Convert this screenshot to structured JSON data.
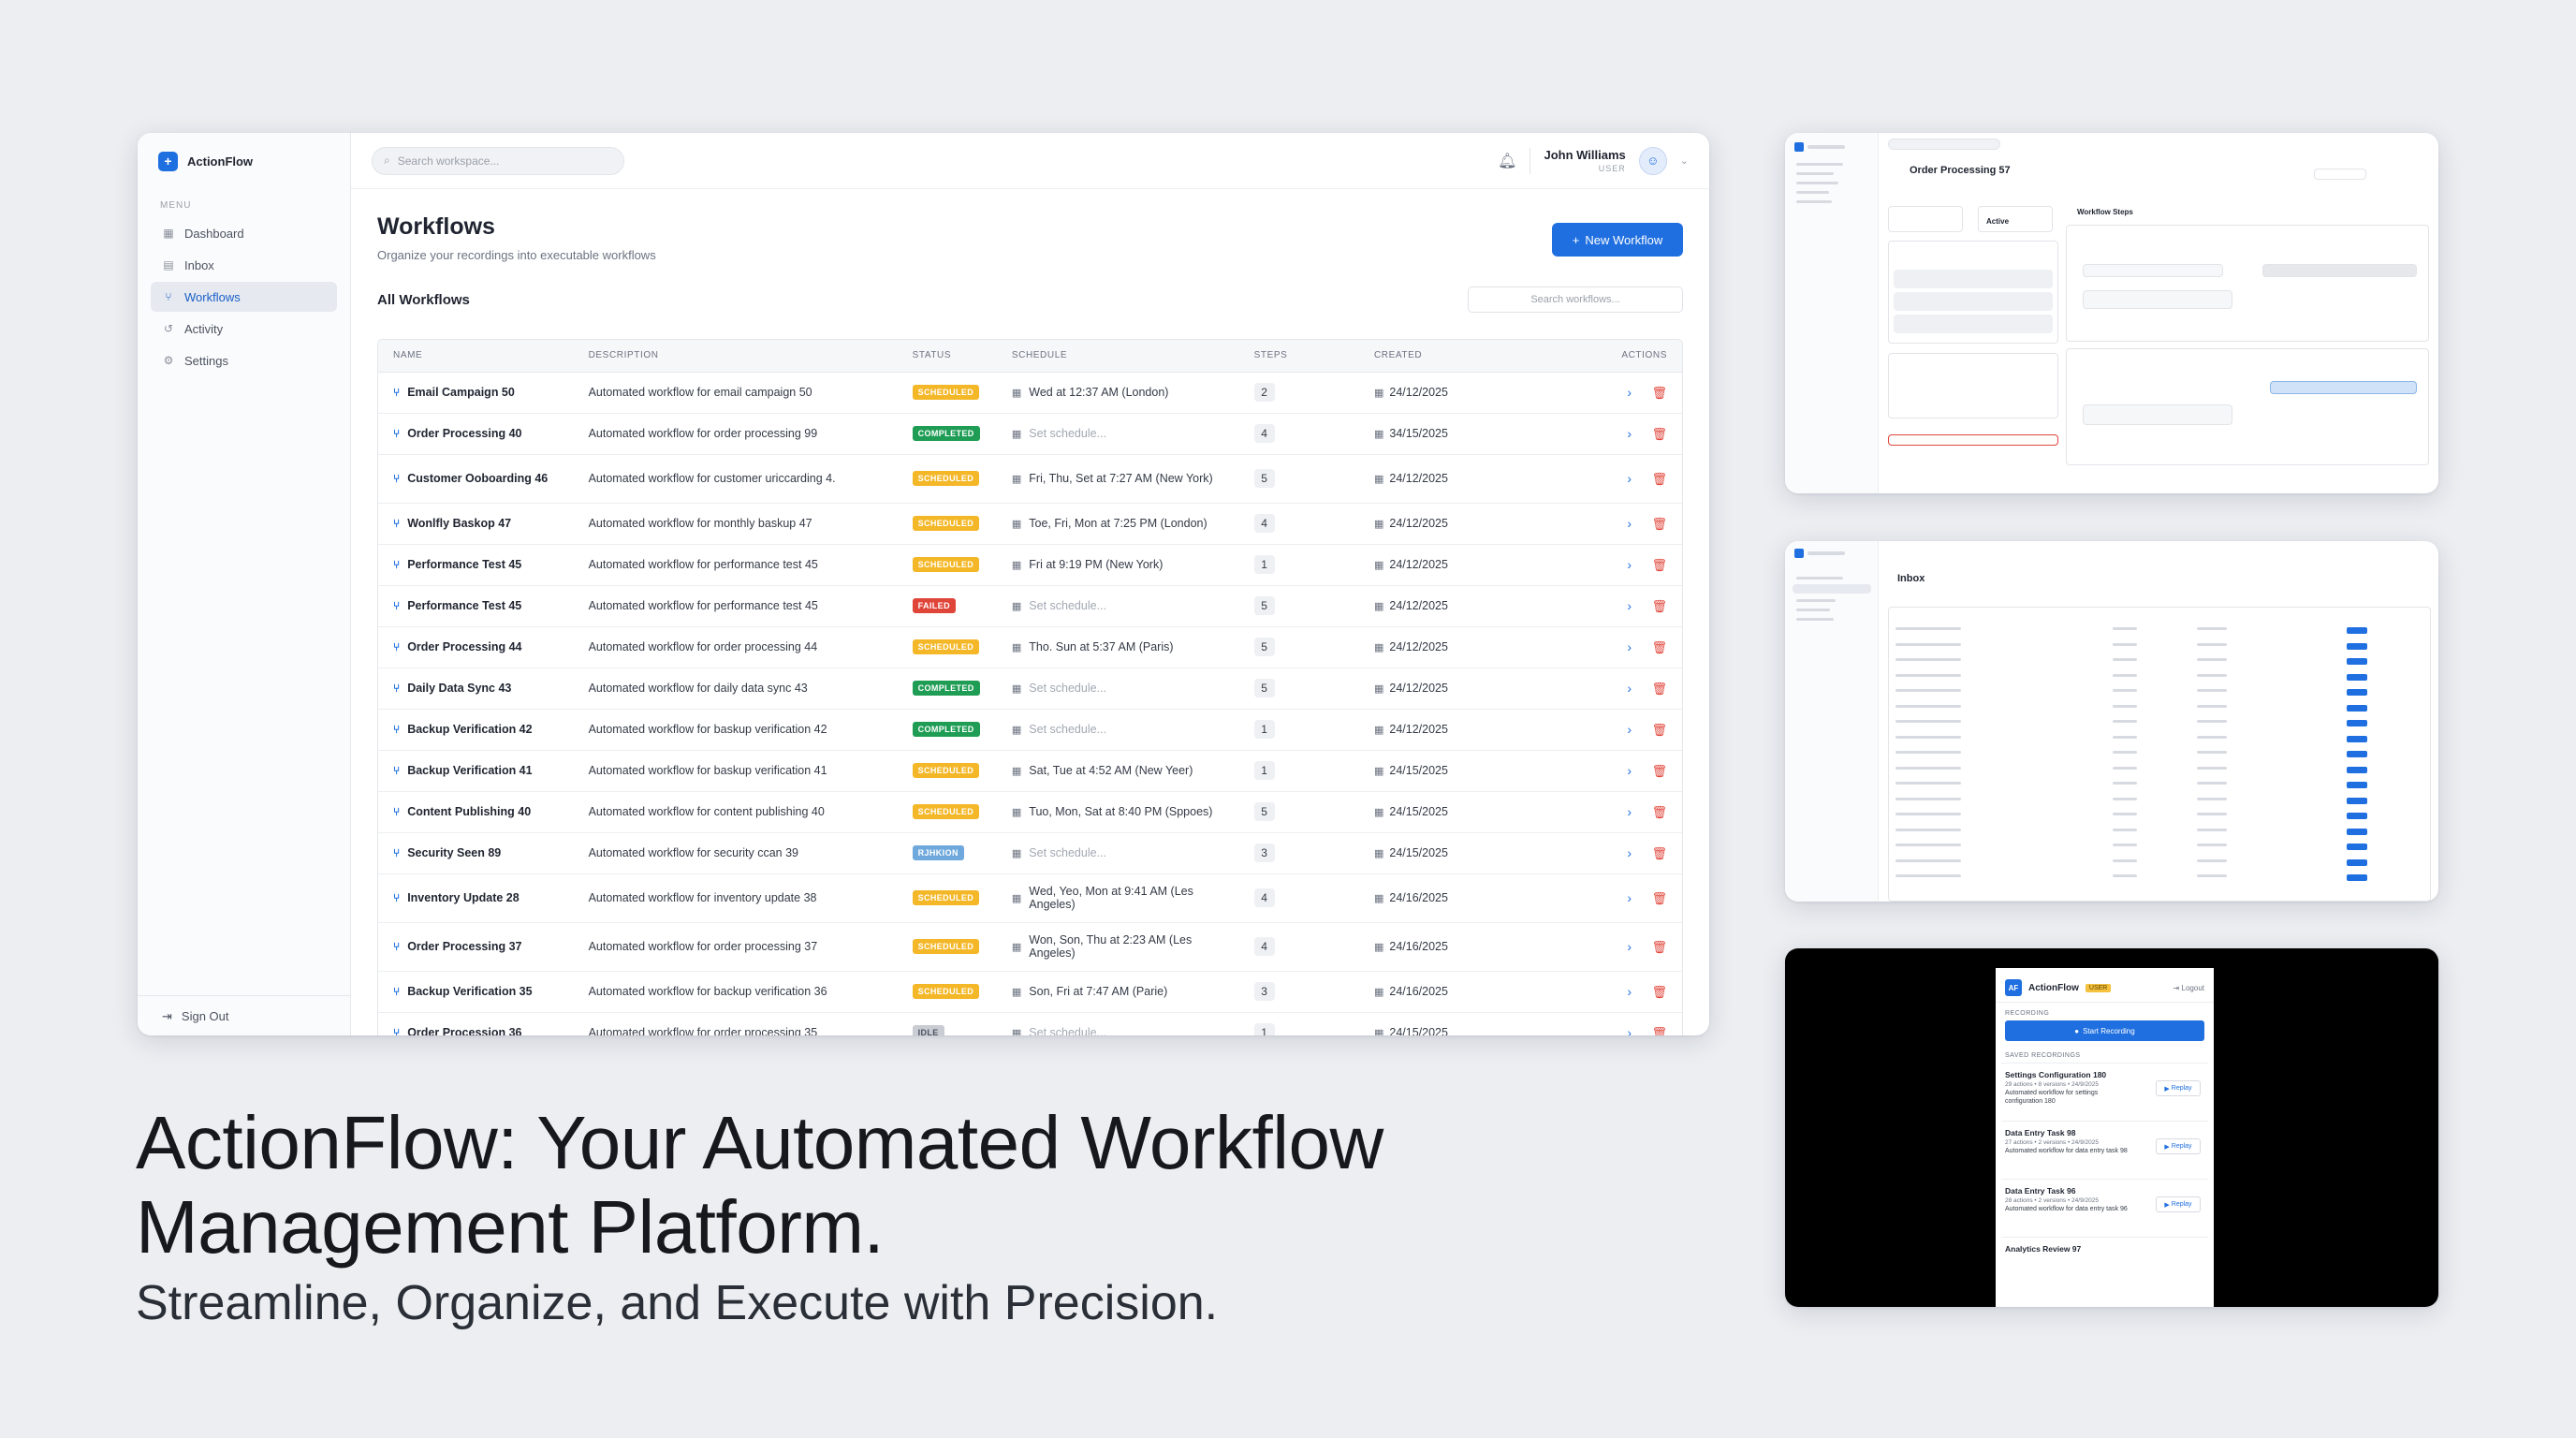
{
  "app": {
    "name": "ActionFlow"
  },
  "sidebar": {
    "menu_label": "MENU",
    "items": [
      {
        "label": "Dashboard",
        "icon": "grid-icon"
      },
      {
        "label": "Inbox",
        "icon": "inbox-icon"
      },
      {
        "label": "Workflows",
        "icon": "workflow-icon",
        "active": true
      },
      {
        "label": "Activity",
        "icon": "history-icon"
      },
      {
        "label": "Settings",
        "icon": "gear-icon"
      }
    ],
    "sign_out": "Sign Out"
  },
  "topbar": {
    "search_placeholder": "Search workspace...",
    "user_name": "John Williams",
    "user_role": "USER"
  },
  "page": {
    "title": "Workflows",
    "subtitle": "Organize your recordings into executable workflows",
    "new_button": "New Workflow",
    "section_title": "All Workflows",
    "search_placeholder": "Search workflows..."
  },
  "table": {
    "headers": [
      "NAME",
      "DESCRIPTION",
      "STATUS",
      "SCHEDULE",
      "STEPS",
      "CREATED",
      "ACTIONS"
    ],
    "rows": [
      {
        "name": "Email Campaign 50",
        "description": "Automated workflow for email campaign 50",
        "status": "SCHEDULED",
        "schedule": "Wed at 12:37 AM (London)",
        "steps": "2",
        "created": "24/12/2025"
      },
      {
        "name": "Order Processing 40",
        "description": "Automated workflow for order processing 99",
        "status": "COMPLETED",
        "schedule": "Set schedule...",
        "placeholder": true,
        "steps": "4",
        "created": "34/15/2025"
      },
      {
        "name": "Customer Ooboarding 46",
        "description": "Automated workflow for customer uriccarding 4.",
        "status": "SCHEDULED",
        "schedule": "Fri, Thu, Set at 7:27 AM (New York)",
        "steps": "5",
        "created": "24/12/2025",
        "tall": true
      },
      {
        "name": "Wonlfly Baskop 47",
        "description": "Automated workflow for monthly baskup 47",
        "status": "SCHEDULED",
        "schedule": "Toe, Fri, Mon at 7:25 PM (London)",
        "steps": "4",
        "created": "24/12/2025"
      },
      {
        "name": "Performance Test 45",
        "description": "Automated workflow for performance test 45",
        "status": "SCHEDULED",
        "schedule": "Fri at 9:19 PM (New York)",
        "steps": "1",
        "created": "24/12/2025"
      },
      {
        "name": "Performance Test 45",
        "description": "Automated workflow for performance test 45",
        "status": "FAILED",
        "schedule": "Set schedule...",
        "placeholder": true,
        "steps": "5",
        "created": "24/12/2025"
      },
      {
        "name": "Order Processing 44",
        "description": "Automated workflow for order processing 44",
        "status": "SCHEDULED",
        "schedule": "Tho. Sun at 5:37 AM (Paris)",
        "steps": "5",
        "created": "24/12/2025"
      },
      {
        "name": "Daily Data Sync 43",
        "description": "Automated workflow for daily data sync 43",
        "status": "COMPLETED",
        "schedule": "Set schedule...",
        "placeholder": true,
        "steps": "5",
        "created": "24/12/2025"
      },
      {
        "name": "Backup Verification 42",
        "description": "Automated workflow for baskup verification 42",
        "status": "COMPLETED",
        "schedule": "Set schedule...",
        "placeholder": true,
        "steps": "1",
        "created": "24/12/2025"
      },
      {
        "name": "Backup Verification 41",
        "description": "Automated workflow for baskup verification 41",
        "status": "SCHEDULED",
        "schedule": "Sat, Tue at 4:52 AM (New Yeer)",
        "steps": "1",
        "created": "24/15/2025"
      },
      {
        "name": "Content Publishing 40",
        "description": "Automated workflow for content publishing 40",
        "status": "SCHEDULED",
        "schedule": "Tuo, Mon, Sat at 8:40 PM (Sppoes)",
        "steps": "5",
        "created": "24/15/2025"
      },
      {
        "name": "Security Seen 89",
        "description": "Automated workflow for security ccan 39",
        "status": "RJHKION",
        "schedule": "Set schedule...",
        "placeholder": true,
        "steps": "3",
        "created": "24/15/2025"
      },
      {
        "name": "Inventory Update 28",
        "description": "Automated workflow for inventory update 38",
        "status": "SCHEDULED",
        "schedule": "Wed, Yeo, Mon at 9:41 AM (Les Angeles)",
        "steps": "4",
        "created": "24/16/2025",
        "tall": true
      },
      {
        "name": "Order Processing 37",
        "description": "Automated workflow for order processing 37",
        "status": "SCHEDULED",
        "schedule": "Won, Son, Thu at 2:23 AM (Les Angeles)",
        "steps": "4",
        "created": "24/16/2025",
        "tall": true
      },
      {
        "name": "Backup Verification 35",
        "description": "Automated workflow for backup verification 36",
        "status": "SCHEDULED",
        "schedule": "Son, Fri at 7:47 AM (Parie)",
        "steps": "3",
        "created": "24/16/2025"
      },
      {
        "name": "Order Procession 36",
        "description": "Automated workflow for order processing 35",
        "status": "IDLE",
        "schedule": "Set schedule...",
        "placeholder": true,
        "steps": "1",
        "created": "24/15/2025"
      }
    ]
  },
  "status_colors": {
    "SCHEDULED": "#f4b728",
    "COMPLETED": "#1f9d55",
    "FAILED": "#e0453a",
    "RJHKION": "#6fa8dc",
    "IDLE": "#c9ccd2"
  },
  "marketing": {
    "headline": "ActionFlow: Your Automated Workflow Management Platform.",
    "tagline": "Streamline, Organize, and Execute with Precision."
  },
  "thumbnails": {
    "detail_title": "Order Processing 57",
    "detail_status": "Active",
    "detail_steps_label": "Workflow Steps",
    "inbox_title": "Inbox",
    "popup": {
      "title": "ActionFlow",
      "badge": "USER",
      "logout": "Logout",
      "recording_label": "RECORDING",
      "start_button": "Start Recording",
      "saved_label": "SAVED RECORDINGS",
      "recordings": [
        {
          "name": "Settings Configuration 180",
          "meta": "29 actions • 8 versions • 24/9/2025",
          "desc": "Automated workflow for settings configuration 180"
        },
        {
          "name": "Data Entry Task 98",
          "meta": "27 actions • 2 versions • 24/9/2025",
          "desc": "Automated workflow for data entry task 98"
        },
        {
          "name": "Data Entry Task 96",
          "meta": "28 actions • 2 versions • 24/9/2025",
          "desc": "Automated workflow for data entry task 96"
        },
        {
          "name": "Analytics Review 97",
          "meta": "",
          "desc": ""
        }
      ],
      "replay_label": "Replay"
    }
  }
}
